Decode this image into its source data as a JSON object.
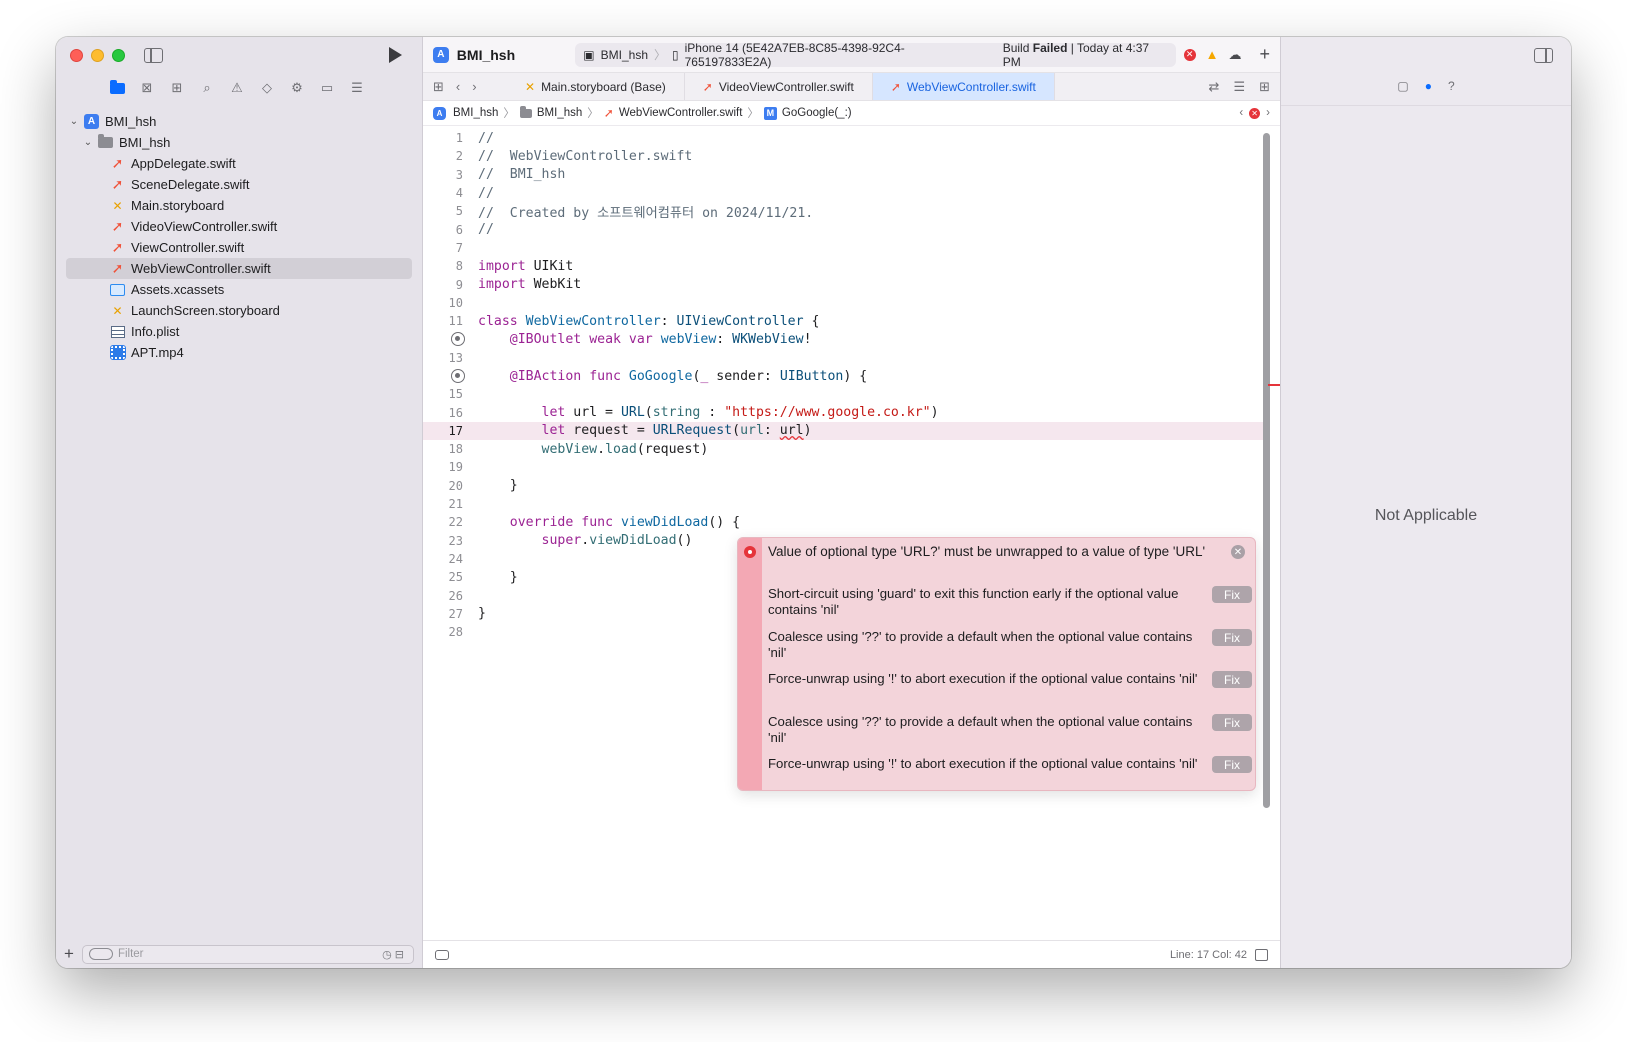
{
  "toolbar": {
    "project_title": "BMI_hsh",
    "scheme": "BMI_hsh",
    "device": "iPhone 14 (5E42A7EB-8C85-4398-92C4-765197833E2A)",
    "status_prefix": "Build",
    "status_result": "Failed",
    "status_time": "Today at 4:37 PM"
  },
  "navigator": {
    "items": [
      {
        "label": "BMI_hsh",
        "type": "project",
        "level": 0
      },
      {
        "label": "BMI_hsh",
        "type": "group",
        "level": 1
      },
      {
        "label": "AppDelegate.swift",
        "type": "swift",
        "level": 2
      },
      {
        "label": "SceneDelegate.swift",
        "type": "swift",
        "level": 2
      },
      {
        "label": "Main.storyboard",
        "type": "storyboard",
        "level": 2
      },
      {
        "label": "VideoViewController.swift",
        "type": "swift",
        "level": 2
      },
      {
        "label": "ViewController.swift",
        "type": "swift",
        "level": 2
      },
      {
        "label": "WebViewController.swift",
        "type": "swift",
        "level": 2,
        "selected": true
      },
      {
        "label": "Assets.xcassets",
        "type": "assets",
        "level": 2
      },
      {
        "label": "LaunchScreen.storyboard",
        "type": "storyboard",
        "level": 2
      },
      {
        "label": "Info.plist",
        "type": "plist",
        "level": 2
      },
      {
        "label": "APT.mp4",
        "type": "video",
        "level": 2
      }
    ],
    "filter_placeholder": "Filter"
  },
  "tabs": [
    {
      "label": "Main.storyboard (Base)",
      "icon": "storyboard"
    },
    {
      "label": "VideoViewController.swift",
      "icon": "swift"
    },
    {
      "label": "WebViewController.swift",
      "icon": "swift",
      "active": true
    }
  ],
  "jumpbar": {
    "project": "BMI_hsh",
    "group": "BMI_hsh",
    "file": "WebViewController.swift",
    "symbol": "GoGoogle(_:)"
  },
  "code": {
    "l1": "//",
    "l2": "//  WebViewController.swift",
    "l3": "//  BMI_hsh",
    "l4": "//",
    "l5": "//  Created by 소프트웨어컴퓨터 on 2024/11/21.",
    "l6": "//"
  },
  "issue": {
    "title": "Value of optional type 'URL?' must be unwrapped to a value of type 'URL'",
    "fix_label": "Fix",
    "fixes": [
      "Short-circuit using 'guard' to exit this function early if the optional value contains 'nil'",
      "Coalesce using '??' to provide a default when the optional value contains 'nil'",
      "Force-unwrap using '!' to abort execution if the optional value contains 'nil'",
      "Coalesce using '??' to provide a default when the optional value contains 'nil'",
      "Force-unwrap using '!' to abort execution if the optional value contains 'nil'"
    ]
  },
  "statusbar": {
    "position": "Line: 17  Col: 42"
  },
  "inspector": {
    "empty_text": "Not Applicable"
  }
}
